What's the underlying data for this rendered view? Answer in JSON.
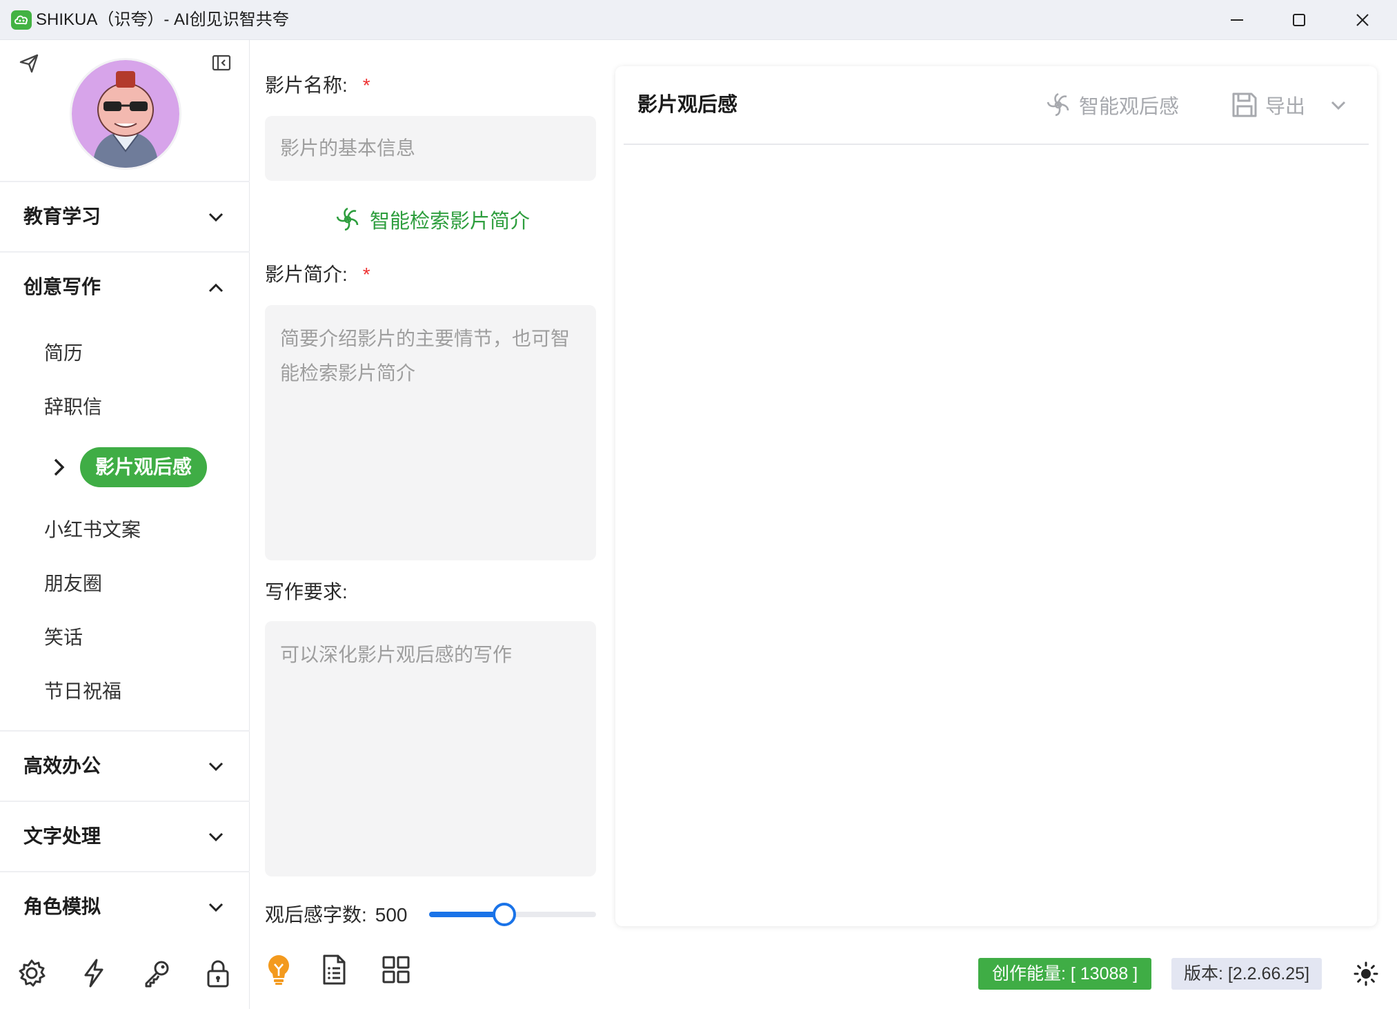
{
  "window": {
    "title": "SHIKUA（识夸）- AI创见识智共夸"
  },
  "sidebar": {
    "groups": [
      {
        "label": "教育学习",
        "expanded": false
      },
      {
        "label": "创意写作",
        "expanded": true
      },
      {
        "label": "高效办公",
        "expanded": false
      },
      {
        "label": "文字处理",
        "expanded": false
      },
      {
        "label": "角色模拟",
        "expanded": false
      }
    ],
    "creative_items": [
      "简历",
      "辞职信",
      "影片观后感",
      "小红书文案",
      "朋友圈",
      "笑话",
      "节日祝福"
    ],
    "active_item": "影片观后感",
    "bottom_icons": [
      "settings-icon",
      "lightning-icon",
      "key-icon",
      "lock-icon"
    ],
    "accent_color": "#3fad45"
  },
  "form": {
    "title_label": "影片名称:",
    "title_placeholder": "影片的基本信息",
    "search_button": "智能检索影片简介",
    "synopsis_label": "影片简介:",
    "synopsis_placeholder": "简要介绍影片的主要情节，也可智能检索影片简介",
    "requirements_label": "写作要求:",
    "requirements_placeholder": "可以深化影片观后感的写作",
    "word_count_label": "观后感字数:",
    "word_count_value": "500",
    "word_count_fraction": 0.45,
    "required_mark": "*",
    "bottom_icons": [
      "lightbulb-icon",
      "document-list-icon",
      "grid-icon"
    ]
  },
  "result": {
    "title": "影片观后感",
    "generate_button": "智能观后感",
    "export_button": "导出"
  },
  "status": {
    "energy": "创作能量: [ 13088 ]",
    "version": "版本: [2.2.66.25]"
  }
}
